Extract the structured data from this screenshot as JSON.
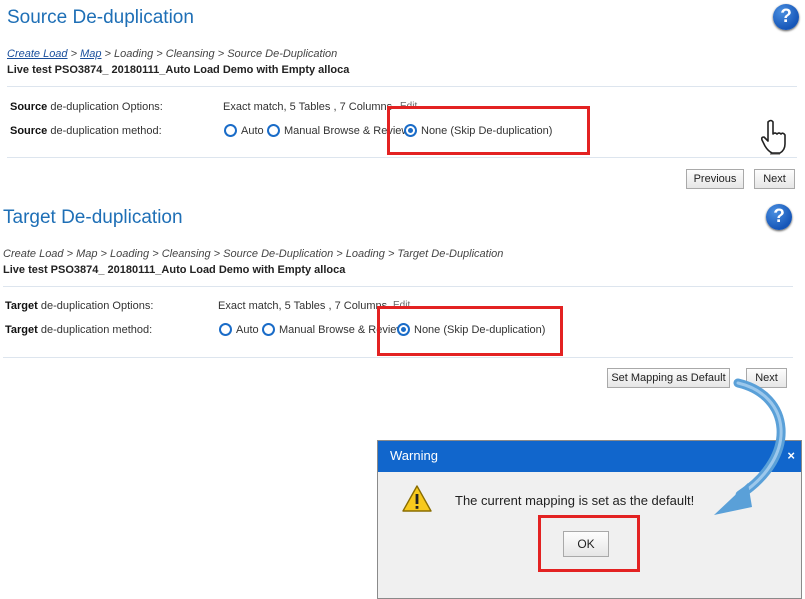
{
  "source": {
    "title": "Source De-duplication",
    "help": "?",
    "breadcrumb": [
      "Create Load",
      "Map",
      "Loading",
      "Cleansing",
      "Source De-Duplication"
    ],
    "breadcrumb_sep": " > ",
    "subtitle": "Live test PSO3874_ 20180111_Auto Load Demo with Empty alloca",
    "options_label_bold": "Source",
    "options_label_rest": " de-duplication Options:",
    "options_value": "Exact match, 5 Tables , 7 Columns",
    "edit": "Edit",
    "method_label_bold": "Source",
    "method_label_rest": " de-duplication method:",
    "methods": [
      "Auto",
      "Manual Browse & Review",
      "None (Skip De-duplication)"
    ],
    "selected_method": "None (Skip De-duplication)",
    "previous_label": "Previous",
    "next_label": "Next"
  },
  "target": {
    "title": "Target De-duplication",
    "help": "?",
    "breadcrumb": [
      "Create Load",
      "Map",
      "Loading",
      "Cleansing",
      "Source De-Duplication",
      "Loading",
      "Target De-Duplication"
    ],
    "breadcrumb_text": "Create Load > Map > Loading > Cleansing > Source De-Duplication > Loading > Target De-Duplication",
    "subtitle": "Live test PSO3874_ 20180111_Auto Load Demo with Empty alloca",
    "options_label_bold": "Target",
    "options_label_rest": " de-duplication Options:",
    "options_value": "Exact match, 5 Tables , 7 Columns",
    "edit": "Edit",
    "method_label_bold": "Target",
    "method_label_rest": " de-duplication method:",
    "methods": [
      "Auto",
      "Manual Browse & Review",
      "None (Skip De-duplication)"
    ],
    "selected_method": "None (Skip De-duplication)",
    "set_default_label": "Set Mapping as Default",
    "next_label": "Next"
  },
  "dialog": {
    "title": "Warning",
    "close": "×",
    "message": "The current mapping is set as the default!",
    "ok_label": "OK"
  },
  "colors": {
    "accent": "#1e6fb6",
    "highlight": "#e32222",
    "dialog_title": "#1166cc",
    "arrow": "#5aa0d8"
  },
  "icons": [
    "help-icon",
    "pointer-hand-icon",
    "warning-icon",
    "curved-arrow-icon"
  ]
}
